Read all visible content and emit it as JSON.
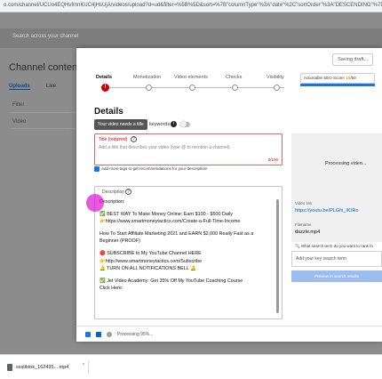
{
  "browser": {
    "url": "o.com/channel/UCUo4EQHvfmnKUC4jHsUjA/videos/upload?d=ud&filter=%5B%5D&sort=%7B\"columnType\"%3A\"date\"%2C\"sortOrder\"%3A\"DESCENDING\"%7D"
  },
  "studio": {
    "search_placeholder": "Search across your channel",
    "title": "Channel content",
    "tabs": [
      "Uploads",
      "Live"
    ],
    "filter_label": "Filter",
    "col_label": "Video"
  },
  "modal": {
    "saving": "Saving draft...",
    "steps": [
      "Details",
      "Monetization",
      "Video elements",
      "Checks",
      "Visibility"
    ],
    "seo": {
      "label": "Actionable SEO Score:",
      "score": "10",
      "max": "/50"
    },
    "details_heading": "Details",
    "tooltip": "Your video needs a title",
    "keywords_label": "keywords",
    "keywords_info": "i",
    "title_label": "Title (required)",
    "title_placeholder": "Add a title that describes your video (type @ to mention a channel)",
    "title_count": "0/100",
    "tags_hint": "Add more tags to get recommendations for your description!",
    "description_label": "Description",
    "description_lines": [
      "Description:",
      "✅ BEST WAY To Make Money Online: Earn $100 - $500 Daily\n👉https://www.smartmoneytactics.com/Create-a-Full-Time-Income",
      "How To Start Affiliate Marketing 2021 and EARN $2,000 Really Fast as a Beginner (PROOF)",
      "🔴 SUBSCRIBE to My YouTube Channel HERE\n👉http://www.smartmoneytactics.com/Subscribe\n🔔 TURN ON ALL NOTIFICATIONS BELL 🔔",
      "✅ Jet Video Academy:  Get 35% Off My YouTube Coaching Course\nClick Here:"
    ],
    "preview_text": "Processing video...",
    "video_link_label": "Video link",
    "video_link": "https://youtu.be/PLGfx_lIORo",
    "filename_label": "Filename",
    "filename": "dazzle.mp4",
    "keyword_search_label": "What search term do you want to rank fo",
    "keyword_placeholder": "Add your key search term",
    "keyword_button": "Preview in search results",
    "footer_status": "Processing 95%..."
  },
  "downloads": {
    "item": "ssstiktok_162435....mp4",
    "chevron": "^"
  }
}
